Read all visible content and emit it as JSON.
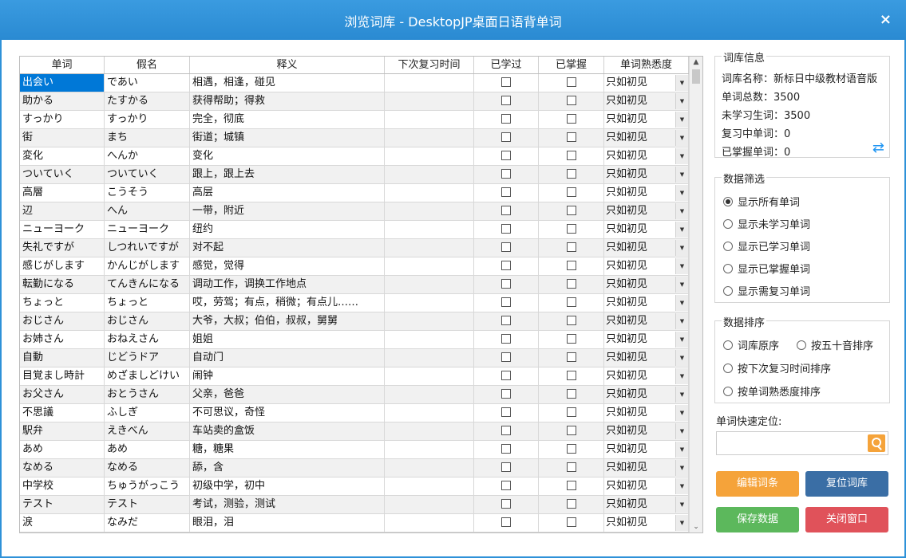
{
  "window": {
    "title": "浏览词库 - DesktopJP桌面日语背单词",
    "close": "×"
  },
  "table": {
    "headers": [
      "单词",
      "假名",
      "释义",
      "下次复习时间",
      "已学过",
      "已掌握",
      "单词熟悉度"
    ],
    "rows": [
      {
        "word": "出会い",
        "kana": "であい",
        "meaning": "相遇，相逢，碰见",
        "next": "",
        "fam": "只如初见"
      },
      {
        "word": "助かる",
        "kana": "たすかる",
        "meaning": "获得帮助；得救",
        "next": "",
        "fam": "只如初见"
      },
      {
        "word": "すっかり",
        "kana": "すっかり",
        "meaning": "完全，彻底",
        "next": "",
        "fam": "只如初见"
      },
      {
        "word": "街",
        "kana": "まち",
        "meaning": "街道；城镇",
        "next": "",
        "fam": "只如初见"
      },
      {
        "word": "変化",
        "kana": "へんか",
        "meaning": "变化",
        "next": "",
        "fam": "只如初见"
      },
      {
        "word": "ついていく",
        "kana": "ついていく",
        "meaning": "跟上，跟上去",
        "next": "",
        "fam": "只如初见"
      },
      {
        "word": "高層",
        "kana": "こうそう",
        "meaning": "高层",
        "next": "",
        "fam": "只如初见"
      },
      {
        "word": "辺",
        "kana": "へん",
        "meaning": "一带，附近",
        "next": "",
        "fam": "只如初见"
      },
      {
        "word": "ニューヨーク",
        "kana": "ニューヨーク",
        "meaning": "纽约",
        "next": "",
        "fam": "只如初见"
      },
      {
        "word": "失礼ですが",
        "kana": "しつれいですが",
        "meaning": "对不起",
        "next": "",
        "fam": "只如初见"
      },
      {
        "word": "感じがします",
        "kana": "かんじがします",
        "meaning": "感觉，觉得",
        "next": "",
        "fam": "只如初见"
      },
      {
        "word": "転勤になる",
        "kana": "てんきんになる",
        "meaning": "调动工作，调换工作地点",
        "next": "",
        "fam": "只如初见"
      },
      {
        "word": "ちょっと",
        "kana": "ちょっと",
        "meaning": "哎，劳驾；有点，稍微；有点儿……",
        "next": "",
        "fam": "只如初见"
      },
      {
        "word": "おじさん",
        "kana": "おじさん",
        "meaning": "大爷，大叔；伯伯，叔叔，舅舅",
        "next": "",
        "fam": "只如初见"
      },
      {
        "word": "お姉さん",
        "kana": "おねえさん",
        "meaning": "姐姐",
        "next": "",
        "fam": "只如初见"
      },
      {
        "word": "自動",
        "kana": "じどうドア",
        "meaning": "自动门",
        "next": "",
        "fam": "只如初见"
      },
      {
        "word": "目覚まし時計",
        "kana": "めざましどけい",
        "meaning": "闹钟",
        "next": "",
        "fam": "只如初见"
      },
      {
        "word": "お父さん",
        "kana": "おとうさん",
        "meaning": "父亲，爸爸",
        "next": "",
        "fam": "只如初见"
      },
      {
        "word": "不思議",
        "kana": "ふしぎ",
        "meaning": "不可思议，奇怪",
        "next": "",
        "fam": "只如初见"
      },
      {
        "word": "駅弁",
        "kana": "えきべん",
        "meaning": "车站卖的盒饭",
        "next": "",
        "fam": "只如初见"
      },
      {
        "word": "あめ",
        "kana": "あめ",
        "meaning": "糖，糖果",
        "next": "",
        "fam": "只如初见"
      },
      {
        "word": "なめる",
        "kana": "なめる",
        "meaning": "舔，含",
        "next": "",
        "fam": "只如初见"
      },
      {
        "word": "中学校",
        "kana": "ちゅうがっこう",
        "meaning": "初级中学，初中",
        "next": "",
        "fam": "只如初见"
      },
      {
        "word": "テスト",
        "kana": "テスト",
        "meaning": "考试，测验，测试",
        "next": "",
        "fam": "只如初见"
      },
      {
        "word": "涙",
        "kana": "なみだ",
        "meaning": "眼泪，泪",
        "next": "",
        "fam": "只如初见"
      }
    ]
  },
  "info": {
    "legend": "词库信息",
    "name": "词库名称：新标日中级教材语音版",
    "total": "单词总数：3500",
    "unlearned": "未学习生词：3500",
    "reviewing": "复习中单词：0",
    "mastered": "已掌握单词：0"
  },
  "filter": {
    "legend": "数据筛选",
    "options": [
      "显示所有单词",
      "显示未学习单词",
      "显示已学习单词",
      "显示已掌握单词",
      "显示需复习单词"
    ]
  },
  "sort": {
    "legend": "数据排序",
    "options": [
      "词库原序",
      "按五十音排序",
      "按下次复习时间排序",
      "按单词熟悉度排序"
    ]
  },
  "quick": {
    "label": "单词快速定位:",
    "placeholder": ""
  },
  "buttons": {
    "edit": "编辑词条",
    "reset": "复位词库",
    "save": "保存数据",
    "close": "关闭窗口"
  },
  "colors": {
    "titlebar": "#2e91d8",
    "edit": "#f5a33a",
    "reset": "#3a6ea5",
    "save": "#5cb85c",
    "close": "#e0525a",
    "selected": "#0078d7"
  }
}
